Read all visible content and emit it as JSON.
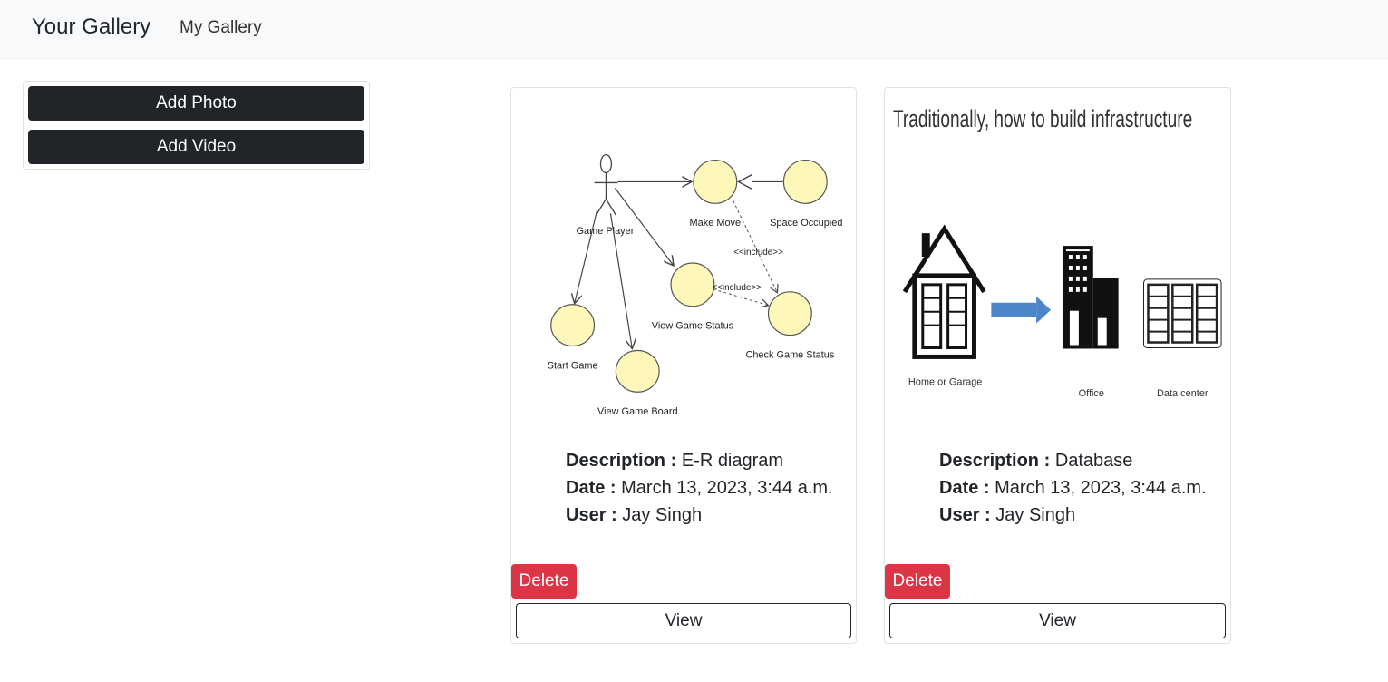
{
  "navbar": {
    "brand": "Your Gallery",
    "link": "My Gallery"
  },
  "sidebar": {
    "add_photo": "Add Photo",
    "add_video": "Add Video"
  },
  "labels": {
    "description": "Description :",
    "date": "Date :",
    "user": "User :"
  },
  "cards": [
    {
      "description": "E-R diagram",
      "date": "March 13, 2023, 3:44 a.m.",
      "user": "Jay Singh",
      "delete_label": "Delete",
      "view_label": "View",
      "image_text": {
        "actor": "Game Player",
        "make_move": "Make Move",
        "space_occupied": "Space Occupied",
        "include1": "<<include>>",
        "include2": "<<include>>",
        "view_game_status": "View Game Status",
        "check_game_status": "Check Game Status",
        "start_game": "Start Game",
        "view_game_board": "View Game Board"
      }
    },
    {
      "description": "Database",
      "date": "March 13, 2023, 3:44 a.m.",
      "user": "Jay Singh",
      "delete_label": "Delete",
      "view_label": "View",
      "image_text": {
        "title": "Traditionally, how to build infrastructure",
        "home": "Home or Garage",
        "office": "Office",
        "datacenter": "Data center"
      }
    }
  ],
  "colors": {
    "dark_button": "#212529",
    "danger_button": "#dc3545",
    "navbar_bg": "#f8f9fa",
    "usecase_fill": "#fdf7b9",
    "arrow_blue": "#4a86c8"
  }
}
